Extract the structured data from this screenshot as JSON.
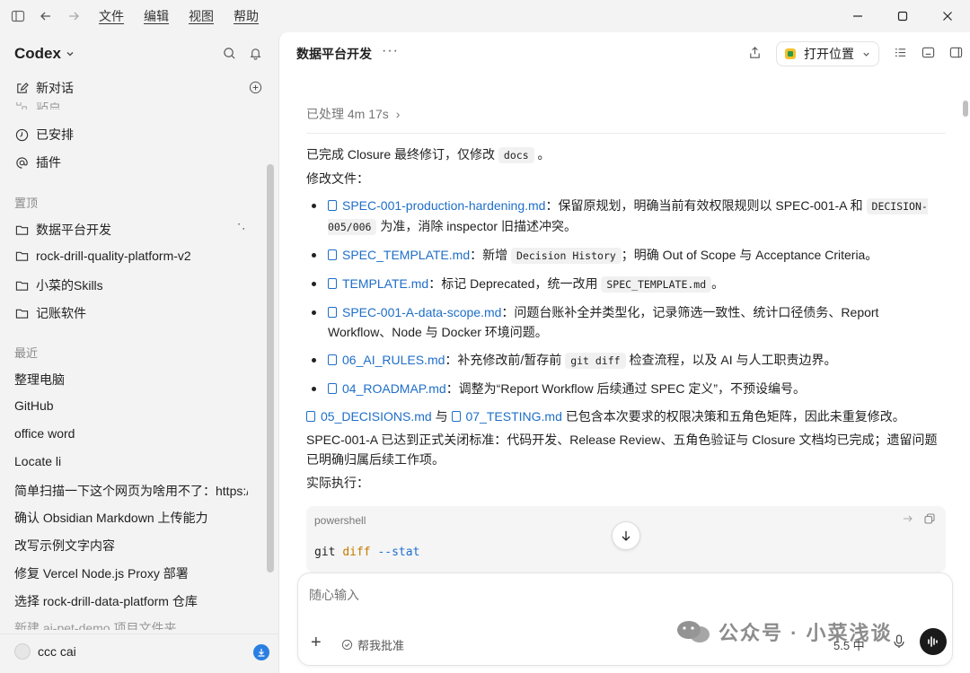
{
  "menu": [
    "文件",
    "编辑",
    "视图",
    "帮助"
  ],
  "sidebar": {
    "brand": "Codex",
    "new_chat": "新对话",
    "partial_item": "站点",
    "nav": [
      "已安排",
      "插件"
    ],
    "pinned_label": "置顶",
    "pinned": [
      "数据平台开发",
      "rock-drill-quality-platform-v2",
      "小菜的Skills",
      "记账软件"
    ],
    "recent_label": "最近",
    "recent": [
      "整理电脑",
      "GitHub",
      "office word",
      "Locate li",
      "简单扫描一下这个网页为啥用不了：https:/",
      "确认 Obsidian Markdown 上传能力",
      "改写示例文字内容",
      "修复 Vercel Node.js Proxy 部署",
      "选择 rock-drill-data-platform 仓库",
      "新建 ai-pet-demo 项目文件夹"
    ],
    "user": "ccc cai"
  },
  "header": {
    "title": "数据平台开发",
    "more": "···",
    "open_label": "打开位置"
  },
  "content": {
    "processed": "已处理 4m 17s",
    "intro_a": "已完成 Closure 最终修订，仅修改",
    "intro_code": "docs",
    "intro_b": "。",
    "modified": "修改文件：",
    "f1_link": "SPEC-001-production-hardening.md",
    "f1_a": "：保留原规划，明确当前有效权限规则以 SPEC-001-A 和",
    "f1_code": "DECISION-005/006",
    "f1_b": "为准，消除 inspector 旧描述冲突。",
    "f2_link": "SPEC_TEMPLATE.md",
    "f2_a": "：新增",
    "f2_code": "Decision History",
    "f2_b": "；明确 Out of Scope 与 Acceptance Criteria。",
    "f3_link": "TEMPLATE.md",
    "f3_a": "：标记 Deprecated，统一改用",
    "f3_code": "SPEC_TEMPLATE.md",
    "f3_b": "。",
    "f4_link": "SPEC-001-A-data-scope.md",
    "f4_a": "：问题台账补全并类型化，记录筛选一致性、统计口径债务、Report Workflow、Node 与 Docker 环境问题。",
    "f5_link": "06_AI_RULES.md",
    "f5_a": "：补充修改前/暂存前",
    "f5_code": "git diff",
    "f5_b": "检查流程，以及 AI 与人工职责边界。",
    "f6_link": "04_ROADMAP.md",
    "f6_a": "：调整为“Report Workflow 后续通过 SPEC 定义”，不预设编号。",
    "d_link1": "05_DECISIONS.md",
    "d_and": "与",
    "d_link2": "07_TESTING.md",
    "d_rest": "已包含本次要求的权限决策和五角色矩阵，因此未重复修改。",
    "summary": "SPEC-001-A 已达到正式关闭标准：代码开发、Release Review、五角色验证与 Closure 文档均已完成；遗留问题已明确归属后续工作项。",
    "actual": "实际执行：",
    "code_lang": "powershell",
    "code_cmd": "git",
    "code_sub": "diff",
    "code_flag": "--stat"
  },
  "composer": {
    "placeholder": "随心输入",
    "review": "帮我批准",
    "model": "5.5 中"
  },
  "watermark": "公众号 · 小菜浅谈"
}
